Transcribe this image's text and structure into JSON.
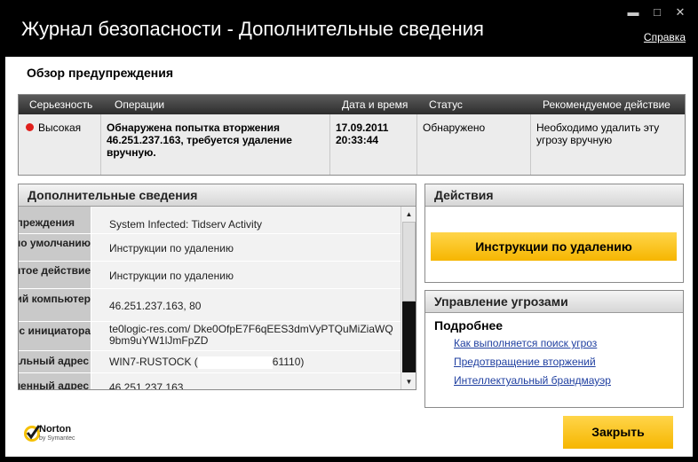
{
  "window": {
    "title": "Журнал безопасности - Дополнительные сведения",
    "help_link": "Справка",
    "controls": {
      "minimize": "▬",
      "maximize": "□",
      "close": "✕"
    }
  },
  "overview": {
    "title": "Обзор предупреждения",
    "columns": [
      "Серьезность",
      "Операции",
      "Дата и время",
      "Статус",
      "Рекомендуемое действие"
    ],
    "row": {
      "severity": "Высокая",
      "severity_color": "#e0201c",
      "operation": "Обнаружена попытка вторжения 46.251.237.163, требуется удаление вручную.",
      "datetime_date": "17.09.2011",
      "datetime_time": "20:33:44",
      "status": "Обнаружено",
      "action": "Необходимо удалить эту угрозу вручную"
    }
  },
  "details": {
    "title": "Дополнительные сведения",
    "rows": [
      {
        "key": "предупреждения",
        "value": "System Infected: Tidserv Activity"
      },
      {
        "key": "Действие по умолчанию",
        "value": "Инструкции по удалению"
      },
      {
        "key": "Предпринятое действие",
        "value": "Инструкции по удалению"
      },
      {
        "key": "Атакующий компьютер",
        "value": "46.251.237.163, 80"
      },
      {
        "key": "URL-адрес инициатора",
        "value": "te0logic-res.com/ Dke0OfpE7F6qEES3dmVyPTQuMiZiaWQ9bm9uYW1lJmFpZD"
      },
      {
        "key": "Локальный адрес",
        "value_prefix": "WIN7-RUSTOCK (",
        "value_suffix": "61110)"
      },
      {
        "key": "Удаленный адрес",
        "value": "46.251.237.163"
      }
    ]
  },
  "actions": {
    "title": "Действия",
    "removal_button": "Инструкции по удалению"
  },
  "threat_management": {
    "title": "Управление угрозами",
    "more_heading": "Подробнее",
    "links": [
      "Как выполняется поиск угроз",
      "Предотвращение вторжений",
      "Интеллектуальный брандмауэр"
    ]
  },
  "footer": {
    "close_button": "Закрыть",
    "logo_text": "Norton",
    "logo_subtext": "by Symantec"
  },
  "colors": {
    "accent": "#f6b600",
    "link": "#1f3fa0",
    "severity_high": "#e0201c"
  }
}
